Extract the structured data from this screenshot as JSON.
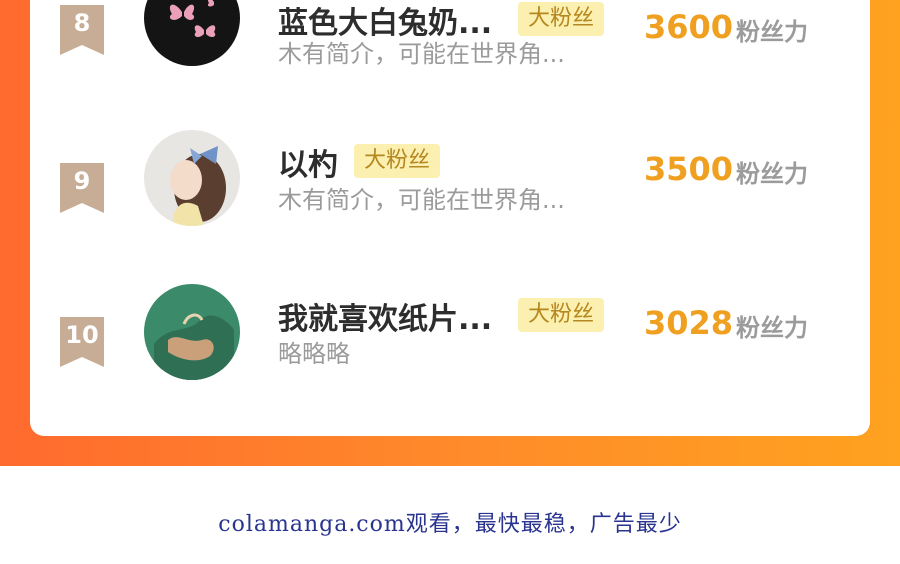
{
  "ranking": {
    "items": [
      {
        "rank": "8",
        "name": "蓝色大白兔奶...",
        "tag": "大粉丝",
        "intro": "木有简介，可能在世界角...",
        "score": "3600",
        "score_unit": "粉丝力",
        "avatar_icon": "butterfly-avatar"
      },
      {
        "rank": "9",
        "name": "以杓",
        "tag": "大粉丝",
        "intro": "木有简介，可能在世界角...",
        "score": "3500",
        "score_unit": "粉丝力",
        "avatar_icon": "girl-avatar"
      },
      {
        "rank": "10",
        "name": "我就喜欢纸片...",
        "tag": "大粉丝",
        "intro": "略略略",
        "score": "3028",
        "score_unit": "粉丝力",
        "avatar_icon": "green-art-avatar"
      }
    ]
  },
  "colors": {
    "gradient_start": "#ff6a2e",
    "gradient_end": "#ffa21f",
    "score": "#f0a020",
    "tag_bg": "#fcf0b0",
    "badge": "#c8ad96"
  },
  "footer": {
    "text": "colamanga.com观看，最快最稳，广告最少"
  }
}
